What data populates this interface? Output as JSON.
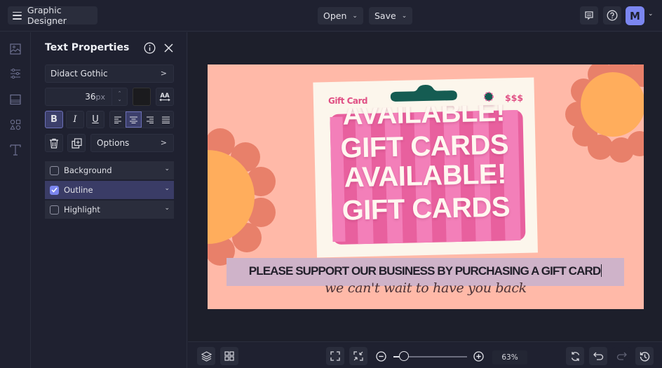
{
  "topbar": {
    "app_title": "Graphic Designer",
    "open_label": "Open",
    "save_label": "Save",
    "avatar_initial": "M",
    "icons": [
      "menu-icon",
      "comment-icon",
      "help-icon",
      "chevron-down-icon"
    ]
  },
  "rail": {
    "items": [
      "image-icon",
      "adjustments-icon",
      "background-icon",
      "shapes-icon",
      "text-icon"
    ]
  },
  "panel": {
    "title": "Text Properties",
    "font_family": "Didact Gothic",
    "font_size": "36",
    "font_size_unit": "px",
    "text_color": "#1b1b1e",
    "bold_label": "B",
    "italic_label": "I",
    "underline_label": "U",
    "bold_active": true,
    "alignment": "center",
    "options_label": "Options",
    "accordions": [
      {
        "label": "Background",
        "checked": false
      },
      {
        "label": "Outline",
        "checked": true
      },
      {
        "label": "Highlight",
        "checked": false
      }
    ]
  },
  "canvas": {
    "background_color": "#ffb9a8",
    "gift_card_label": "Gift Card",
    "price_label": "$$$",
    "headline_lines": [
      "AVAILABLE!",
      "GIFT CARDS",
      "AVAILABLE!",
      "GIFT CARDS"
    ],
    "selected_text": "PLEASE SUPPORT OUR BUSINESS BY PURCHASING A GIFT CARD",
    "script_text": "we can't wait to have you back",
    "colors": {
      "petal": "#e8806a",
      "sun": "#ffad5c",
      "card_bg": "#fcf6ec",
      "card_pink": "#e8609e",
      "stripe": "#f37fb9",
      "hanger": "#155c52",
      "selection": "#cfb3c9"
    }
  },
  "bottombar": {
    "zoom_value": "63%",
    "zoom_fraction": 0.05
  }
}
